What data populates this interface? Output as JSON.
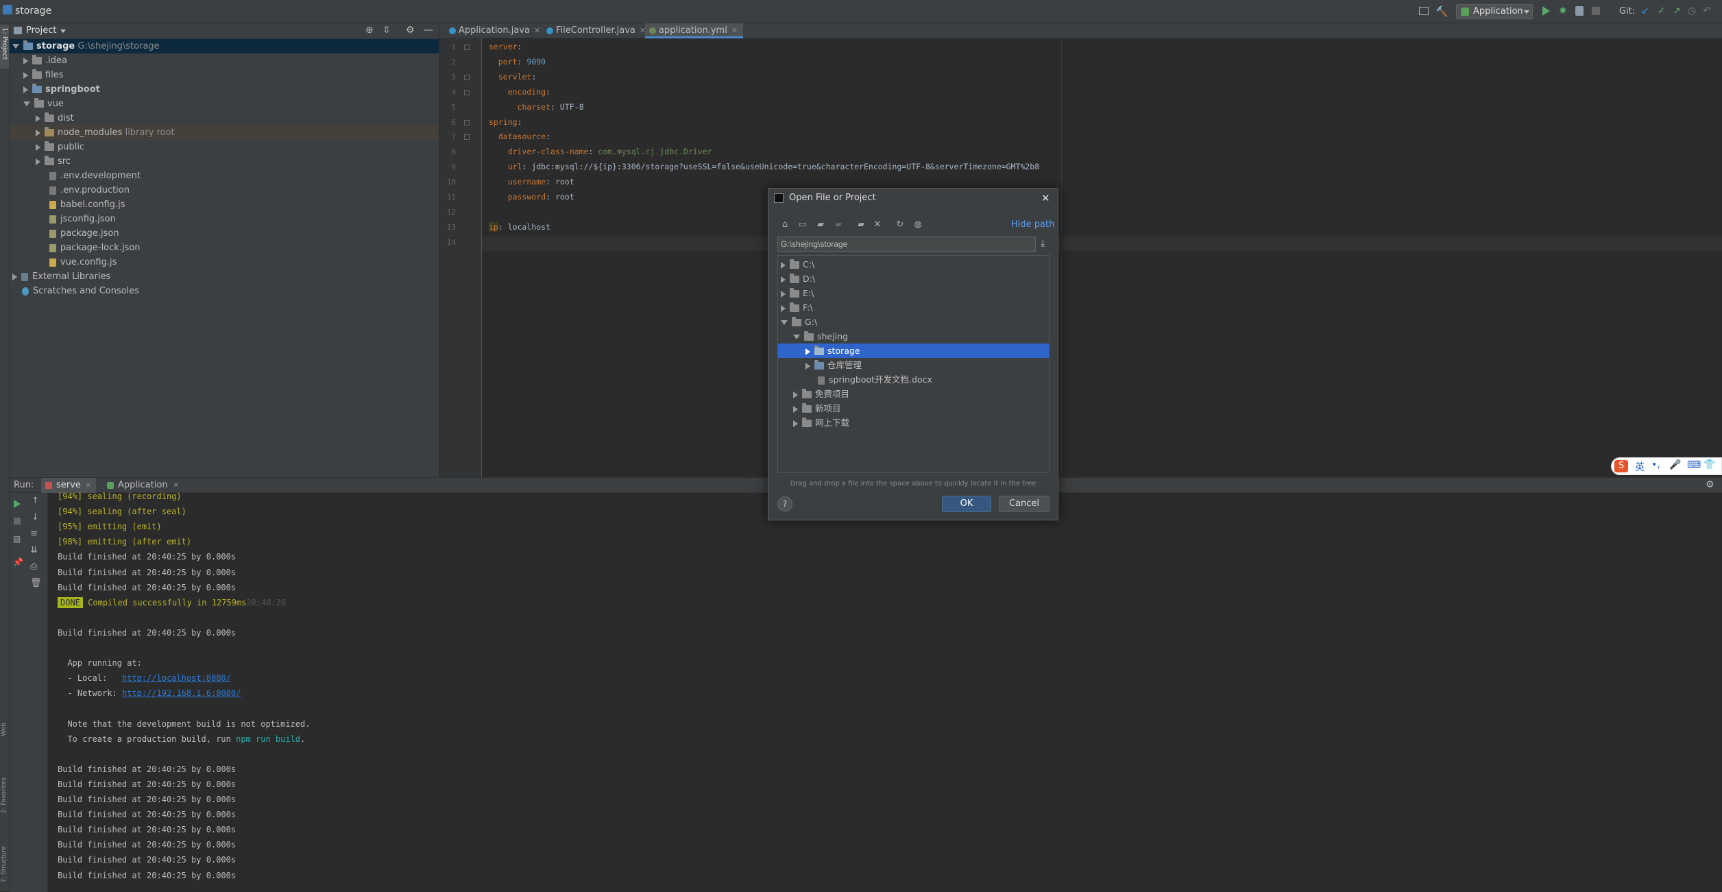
{
  "window": {
    "title": "storage"
  },
  "toolbar": {
    "run_config": "Application",
    "git_label": "Git:"
  },
  "left_strip": {
    "project_label": "1: Project",
    "structure_label": "7: Structure",
    "favorites_label": "2: Favorites",
    "web_label": "Web"
  },
  "project": {
    "header": "Project",
    "tree": [
      {
        "label": "storage",
        "hint": "G:\\shejing\\storage"
      },
      {
        "label": ".idea"
      },
      {
        "label": "files"
      },
      {
        "label": "springboot"
      },
      {
        "label": "vue"
      },
      {
        "label": "dist"
      },
      {
        "label": "node_modules",
        "hint": "library root"
      },
      {
        "label": "public"
      },
      {
        "label": "src"
      },
      {
        "label": ".env.development"
      },
      {
        "label": ".env.production"
      },
      {
        "label": "babel.config.js"
      },
      {
        "label": "jsconfig.json"
      },
      {
        "label": "package.json"
      },
      {
        "label": "package-lock.json"
      },
      {
        "label": "vue.config.js"
      },
      {
        "label": "External Libraries"
      },
      {
        "label": "Scratches and Consoles"
      }
    ]
  },
  "editor": {
    "tabs": [
      {
        "label": "Application.java"
      },
      {
        "label": "FileController.java"
      },
      {
        "label": "application.yml"
      }
    ],
    "line_numbers": [
      "1",
      "2",
      "3",
      "4",
      "5",
      "6",
      "7",
      "8",
      "9",
      "10",
      "11",
      "12",
      "13",
      "14"
    ],
    "lines": [
      {
        "key": "server",
        "sep": ":",
        "val": ""
      },
      {
        "key": "  port",
        "sep": ": ",
        "val": "9090"
      },
      {
        "key": "  servlet",
        "sep": ":",
        "val": ""
      },
      {
        "key": "    encoding",
        "sep": ":",
        "val": ""
      },
      {
        "key": "      charset",
        "sep": ": ",
        "val": "UTF-8"
      },
      {
        "key": "spring",
        "sep": ":",
        "val": ""
      },
      {
        "key": "  datasource",
        "sep": ":",
        "val": ""
      },
      {
        "key": "    driver-class-name",
        "sep": ": ",
        "val": "com.mysql.cj.jdbc.Driver"
      },
      {
        "key": "    url",
        "sep": ": ",
        "val": "jdbc:mysql://${ip}:3306/storage?useSSL=false&useUnicode=true&characterEncoding=UTF-8&serverTimezone=GMT%2b8"
      },
      {
        "key": "    username",
        "sep": ": ",
        "val": "root"
      },
      {
        "key": "    password",
        "sep": ": ",
        "val": "root"
      },
      {
        "key": "",
        "sep": "",
        "val": ""
      },
      {
        "key": "ip",
        "sep": ": ",
        "val": "localhost"
      },
      {
        "key": "",
        "sep": "",
        "val": ""
      }
    ]
  },
  "run": {
    "label": "Run:",
    "tabs": [
      {
        "label": "serve"
      },
      {
        "label": "Application"
      }
    ],
    "output": [
      "[94%] sealing (recording)",
      "[94%] sealing (after seal)",
      "[95%] emitting (emit)",
      "[98%] emitting (after emit)",
      "Build finished at 20:40:25 by 0.000s",
      "Build finished at 20:40:25 by 0.000s",
      "Build finished at 20:40:25 by 0.000s"
    ],
    "done_badge": "DONE",
    "compiled": "Compiled successfully in 12759ms",
    "compiled_time": "20:40:28",
    "build_line": "Build finished at 20:40:25 by 0.000s",
    "app_running": "App running at:",
    "local_label": "- Local:   ",
    "local_url": "http://localhost:8080/",
    "network_label": "- Network: ",
    "network_url": "http://192.168.1.6:8080/",
    "note1": "Note that the development build is not optimized.",
    "note2_pre": "To create a production build, run ",
    "note2_cmd": "npm run build",
    "note2_post": ".",
    "tail": [
      "Build finished at 20:40:25 by 0.000s",
      "Build finished at 20:40:25 by 0.000s",
      "Build finished at 20:40:25 by 0.000s",
      "Build finished at 20:40:25 by 0.000s",
      "Build finished at 20:40:25 by 0.000s",
      "Build finished at 20:40:25 by 0.000s",
      "Build finished at 20:40:25 by 0.000s",
      "Build finished at 20:40:25 by 0.000s"
    ]
  },
  "dialog": {
    "title": "Open File or Project",
    "hide_path": "Hide path",
    "path": "G:\\shejing\\storage",
    "tree": [
      {
        "label": "C:\\"
      },
      {
        "label": "D:\\"
      },
      {
        "label": "E:\\"
      },
      {
        "label": "F:\\"
      },
      {
        "label": "G:\\"
      },
      {
        "label": "shejing"
      },
      {
        "label": "storage"
      },
      {
        "label": "仓库管理"
      },
      {
        "label": "springboot开发文档.docx"
      },
      {
        "label": "免费项目"
      },
      {
        "label": "新项目"
      },
      {
        "label": "网上下载"
      }
    ],
    "hint": "Drag and drop a file into the space above to quickly locate it in the tree",
    "ok": "OK",
    "cancel": "Cancel",
    "help": "?"
  },
  "ime": {
    "label": "英"
  },
  "colors": {
    "accent": "#2f65ca",
    "bg": "#2b2b2b",
    "panel": "#3c3f41"
  }
}
